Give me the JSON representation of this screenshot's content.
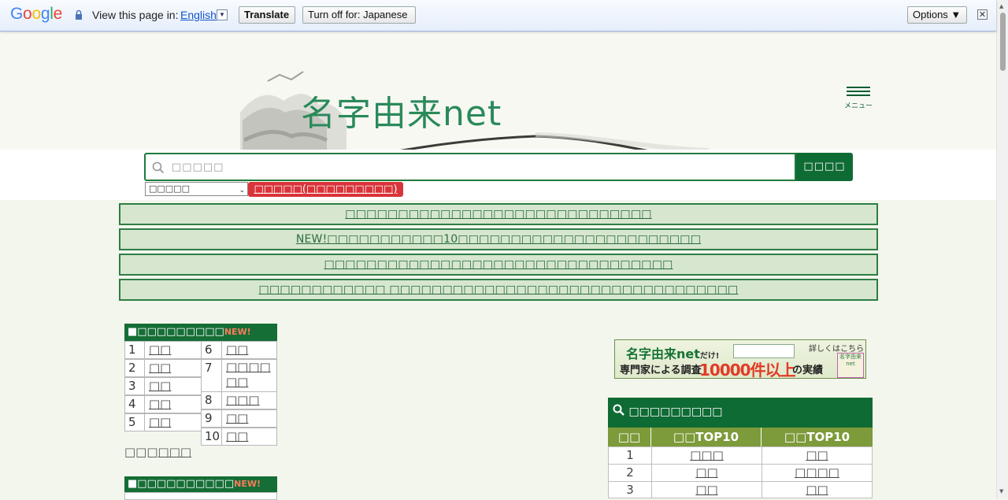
{
  "translate_bar": {
    "logo": "Google",
    "prompt": "View this page in:",
    "language": "English",
    "translate_label": "Translate",
    "turn_off_label": "Turn off for: Japanese",
    "options_label": "Options ▼",
    "close_label": "✕"
  },
  "header": {
    "site_name": "名字由来net",
    "menu_label": "メニュー"
  },
  "search": {
    "placeholder": "□□□□□",
    "button_label": "□□□□",
    "select_value": "□□□□□",
    "red_button_label": "□□□□□(□□□□□□□□□)"
  },
  "news": [
    "□□□□□□□□□□□□□□□□□□□□□□□□□□□□□",
    "NEW!□□□□□□□□□□□10□□□□□□□□□□□□□□□□□□□□□□□",
    "□□□□□□□□□□□□□□□□□□□□□□□□□□□□□□□□□",
    "□□□□□□□□□□□□ □□□□□□□□□□□□□□□□□□□□□□□□□□□□□□□□□"
  ],
  "ranking": {
    "title": "■□□□□□□□□□",
    "new_badge": "NEW!",
    "left": [
      {
        "num": "1",
        "name": "□□"
      },
      {
        "num": "2",
        "name": "□□"
      },
      {
        "num": "3",
        "name": "□□"
      },
      {
        "num": "4",
        "name": "□□"
      },
      {
        "num": "5",
        "name": "□□"
      }
    ],
    "right": [
      {
        "num": "6",
        "name": "□□"
      },
      {
        "num": "7",
        "name": "□□□□□□"
      },
      {
        "num": "8",
        "name": "□□□"
      },
      {
        "num": "9",
        "name": "□□"
      },
      {
        "num": "10",
        "name": "□□"
      }
    ],
    "more_prefix": "□□□",
    "more_link": "□□□"
  },
  "ranking2": {
    "title": "■□□□□□□□□□□",
    "new_badge": "NEW!"
  },
  "banner": {
    "line1": "名字由来net",
    "line1_suffix": "だけ!",
    "line2a": "専門家による調査",
    "line2b": "10000件以上",
    "line2c": "の実績",
    "detail": "詳しくはこちら",
    "seal": "名字由来net"
  },
  "search_ranking": {
    "title": "□□□□□□□□□",
    "columns": [
      "□□",
      "□□TOP10",
      "□□TOP10"
    ],
    "rows": [
      [
        "1",
        "□□□",
        "□□"
      ],
      [
        "2",
        "□□",
        "□□□□"
      ],
      [
        "3",
        "□□",
        "□□"
      ]
    ]
  },
  "colors": {
    "brand_green": "#0f6b34",
    "accent_red": "#d9343a",
    "news_bg": "#d6e6cf",
    "olive": "#7d9b3a"
  }
}
